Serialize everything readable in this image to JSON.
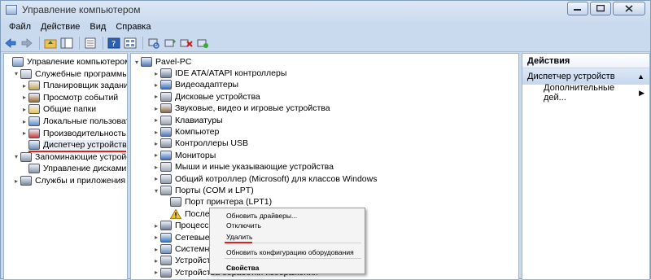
{
  "window": {
    "title": "Управление компьютером"
  },
  "menu": [
    "Файл",
    "Действие",
    "Вид",
    "Справка"
  ],
  "left_tree": {
    "items": [
      {
        "label": "Управление компьютером (л",
        "indent": 0,
        "arrow": "",
        "icon": "computer-management-icon"
      },
      {
        "label": "Служебные программы",
        "indent": 1,
        "arrow": "▾",
        "icon": "tools-icon"
      },
      {
        "label": "Планировщик заданий",
        "indent": 2,
        "arrow": "▸",
        "icon": "clock-icon"
      },
      {
        "label": "Просмотр событий",
        "indent": 2,
        "arrow": "▸",
        "icon": "event-viewer-icon"
      },
      {
        "label": "Общие папки",
        "indent": 2,
        "arrow": "▸",
        "icon": "shared-folder-icon"
      },
      {
        "label": "Локальные пользовате",
        "indent": 2,
        "arrow": "▸",
        "icon": "users-icon"
      },
      {
        "label": "Производительность",
        "indent": 2,
        "arrow": "▸",
        "icon": "performance-icon"
      },
      {
        "label": "Диспетчер устройств",
        "indent": 2,
        "arrow": "",
        "icon": "device-manager-icon",
        "selected": true
      },
      {
        "label": "Запоминающие устройст",
        "indent": 1,
        "arrow": "▾",
        "icon": "storage-icon"
      },
      {
        "label": "Управление дисками",
        "indent": 2,
        "arrow": "",
        "icon": "disk-management-icon"
      },
      {
        "label": "Службы и приложения",
        "indent": 1,
        "arrow": "▸",
        "icon": "services-icon"
      }
    ]
  },
  "device_tree": {
    "root": "Pavel-PC",
    "items": [
      {
        "label": "IDE ATA/ATAPI контроллеры",
        "indent": 1,
        "arrow": "▸",
        "icon": "ide-controller-icon"
      },
      {
        "label": "Видеоадаптеры",
        "indent": 1,
        "arrow": "▸",
        "icon": "display-adapter-icon"
      },
      {
        "label": "Дисковые устройства",
        "indent": 1,
        "arrow": "▸",
        "icon": "disk-drive-icon"
      },
      {
        "label": "Звуковые, видео и игровые устройства",
        "indent": 1,
        "arrow": "▸",
        "icon": "sound-icon"
      },
      {
        "label": "Клавиатуры",
        "indent": 1,
        "arrow": "▸",
        "icon": "keyboard-icon"
      },
      {
        "label": "Компьютер",
        "indent": 1,
        "arrow": "▸",
        "icon": "computer-icon"
      },
      {
        "label": "Контроллеры USB",
        "indent": 1,
        "arrow": "▸",
        "icon": "usb-icon"
      },
      {
        "label": "Мониторы",
        "indent": 1,
        "arrow": "▸",
        "icon": "monitor-icon"
      },
      {
        "label": "Мыши и иные указывающие устройства",
        "indent": 1,
        "arrow": "▸",
        "icon": "mouse-icon"
      },
      {
        "label": "Общий котроллер (Microsoft) для классов Windows",
        "indent": 1,
        "arrow": "▸",
        "icon": "generic-controller-icon"
      },
      {
        "label": "Порты (COM и LPT)",
        "indent": 1,
        "arrow": "▾",
        "icon": "port-icon"
      },
      {
        "label": "Порт принтера (LPT1)",
        "indent": 2,
        "arrow": "",
        "icon": "printer-port-icon"
      },
      {
        "label": "Послед",
        "indent": 2,
        "arrow": "",
        "icon": "warning-icon"
      },
      {
        "label": "Процессор",
        "indent": 1,
        "arrow": "▸",
        "icon": "processor-icon"
      },
      {
        "label": "Сетевые а",
        "indent": 1,
        "arrow": "▸",
        "icon": "network-icon"
      },
      {
        "label": "Системн",
        "indent": 1,
        "arrow": "▸",
        "icon": "system-device-icon"
      },
      {
        "label": "Устройств",
        "indent": 1,
        "arrow": "▸",
        "icon": "hid-icon"
      },
      {
        "label": "Устройства обработки изображений",
        "indent": 1,
        "arrow": "▸",
        "icon": "imaging-icon"
      }
    ]
  },
  "actions": {
    "header": "Действия",
    "group": "Диспетчер устройств",
    "item": "Дополнительные дей..."
  },
  "context_menu": {
    "items": [
      {
        "label": "Обновить драйверы...",
        "bold": false
      },
      {
        "label": "Отключить",
        "bold": false
      },
      {
        "label": "Удалить",
        "bold": false
      },
      {
        "separator": true
      },
      {
        "label": "Обновить конфигурацию оборудования",
        "bold": false
      },
      {
        "separator": true
      },
      {
        "label": "Свойства",
        "bold": true
      }
    ]
  }
}
